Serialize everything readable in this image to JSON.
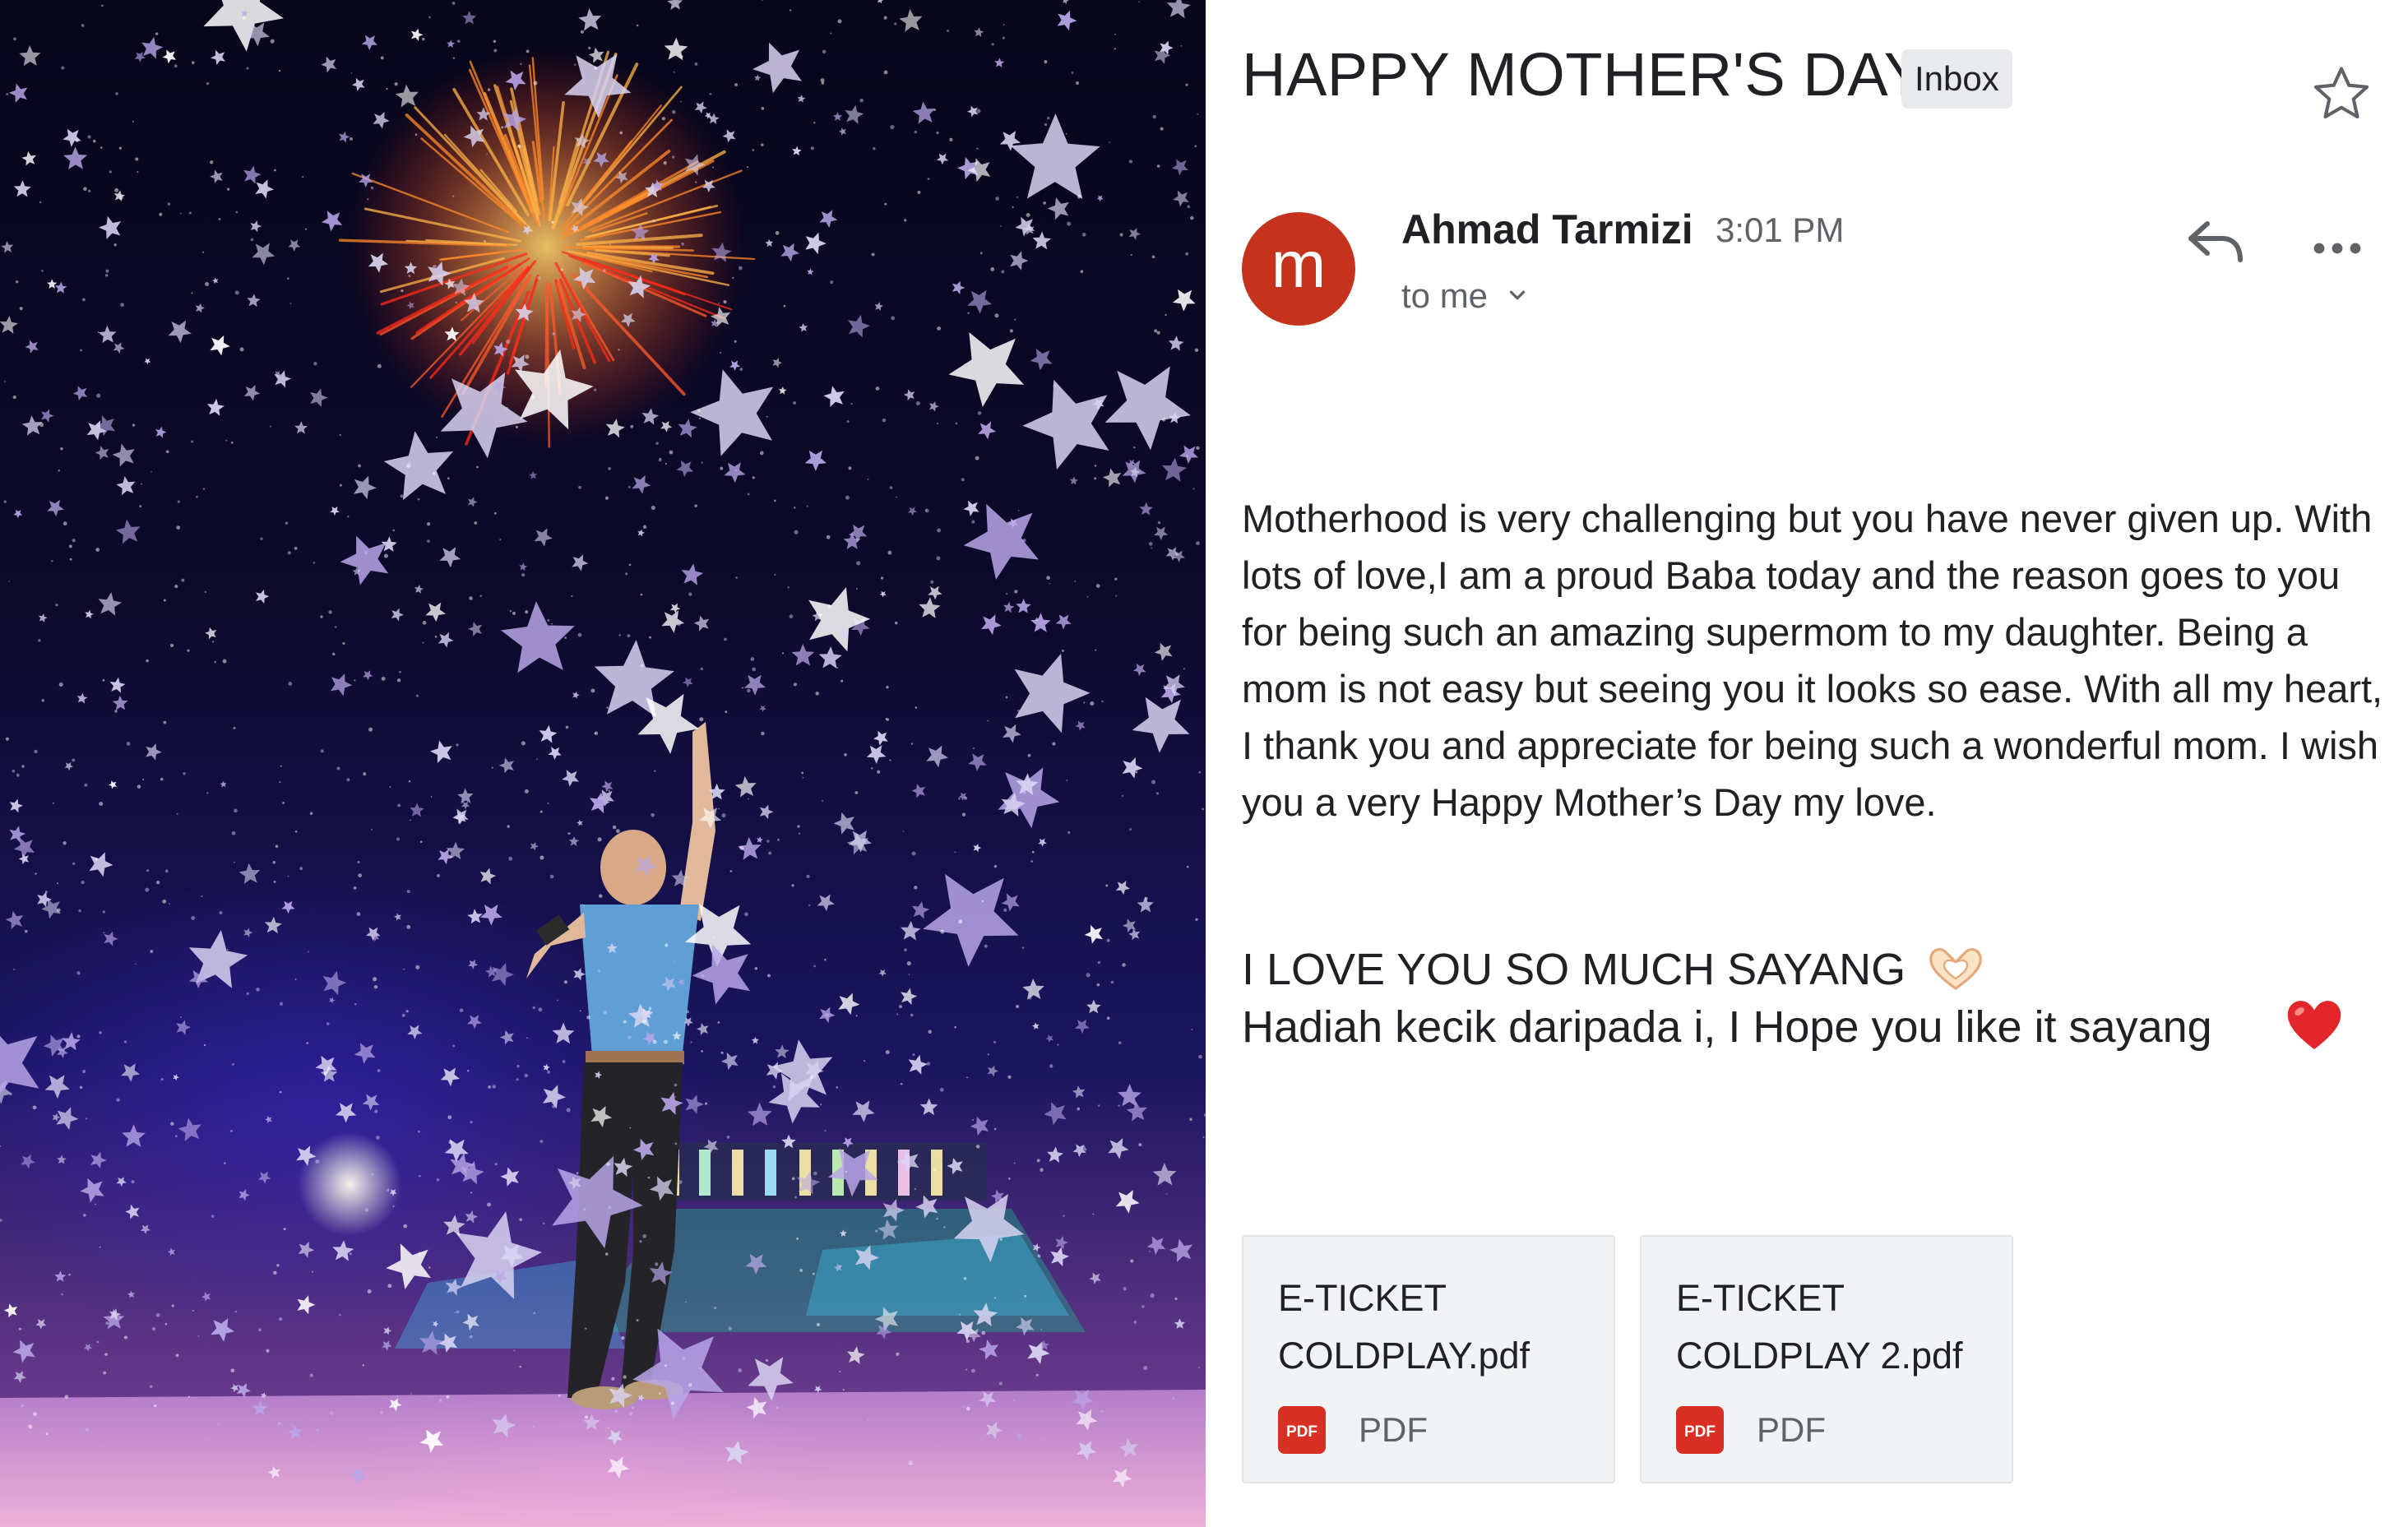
{
  "email": {
    "subject": "HAPPY MOTHER'S DAY",
    "label": "Inbox",
    "sender": {
      "avatar_letter": "m",
      "avatar_color": "#c5321e",
      "name": "Ahmad Tarmizi",
      "time": "3:01 PM",
      "recipient": "to me"
    },
    "body": "Motherhood is very challenging but you have never given up. With lots of love,I am a proud Baba today and the reason goes to you for being such an amazing supermom to my daughter. Being a mom is not easy but seeing you it looks so ease. With all my heart, I thank you and appreciate for being such a wonderful mom. I wish you a very Happy Mother’s Day my love.",
    "love_line": "I LOVE YOU SO MUCH SAYANG",
    "gift_line": "Hadiah kecik daripada i, I Hope you like it sayang",
    "icons": {
      "star": "star-icon",
      "reply": "reply-icon",
      "more": "more-icon",
      "chevron": "chevron-down-icon",
      "hands": "heart-hands-emoji",
      "heart": "red-heart-emoji"
    },
    "attachments": [
      {
        "name": "E-TICKET COLDPLAY.pdf",
        "type": "PDF",
        "icon": "pdf-icon"
      },
      {
        "name": "E-TICKET COLDPLAY 2.pdf",
        "type": "PDF",
        "icon": "pdf-icon"
      }
    ]
  },
  "photo": {
    "description_icon": "concert-photo"
  },
  "colors": {
    "pdf_red": "#d93025",
    "secondary_text": "#5f6368",
    "badge_bg": "#e8eaed"
  }
}
